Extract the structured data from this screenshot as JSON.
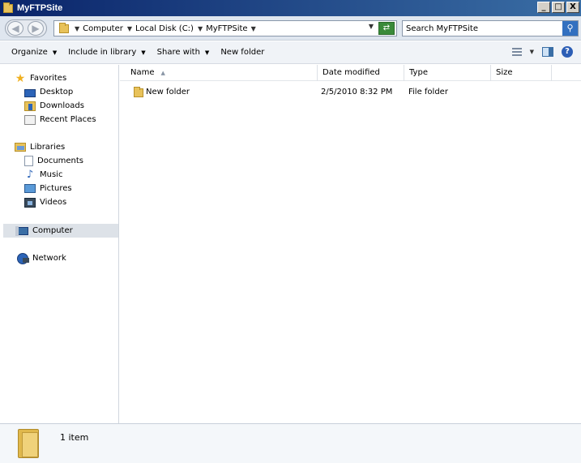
{
  "window": {
    "title": "MyFTPSite",
    "controls": [
      "_",
      "□",
      "X"
    ]
  },
  "address": {
    "breadcrumbs": [
      "Computer",
      "Local Disk (C:)",
      "MyFTPSite"
    ],
    "search_placeholder": "Search MyFTPSite"
  },
  "toolbar": {
    "organize": "Organize",
    "include_in_library": "Include in library",
    "share_with": "Share with",
    "new_folder": "New folder"
  },
  "nav": {
    "favorites": "Favorites",
    "desktop": "Desktop",
    "downloads": "Downloads",
    "recent_places": "Recent Places",
    "libraries": "Libraries",
    "documents": "Documents",
    "music": "Music",
    "pictures": "Pictures",
    "videos": "Videos",
    "computer": "Computer",
    "network": "Network"
  },
  "columns": {
    "name": "Name",
    "date_modified": "Date modified",
    "type": "Type",
    "size": "Size"
  },
  "files": [
    {
      "name": "New folder",
      "date_modified": "2/5/2010 8:32 PM",
      "type": "File folder",
      "size": ""
    }
  ],
  "status": {
    "item_count": "1 item"
  }
}
